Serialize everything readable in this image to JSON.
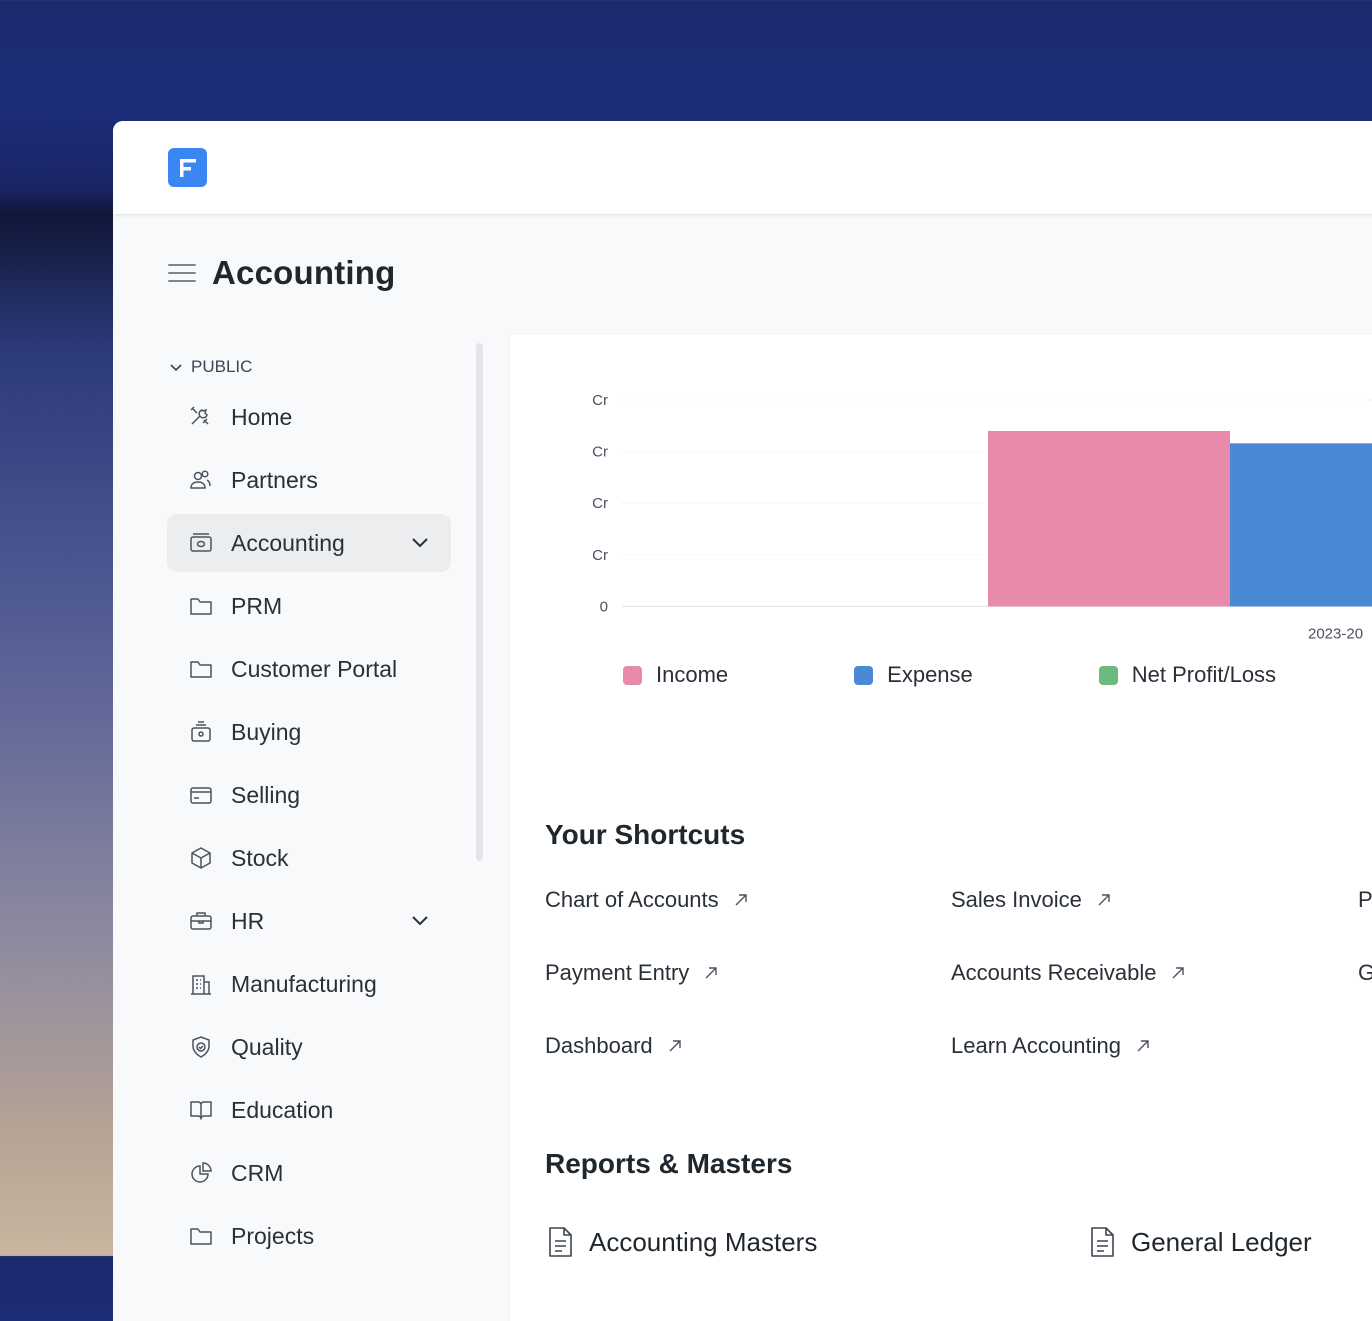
{
  "app": {
    "logo_letter": "F"
  },
  "page": {
    "title": "Accounting"
  },
  "sidebar": {
    "section": "PUBLIC",
    "items": [
      {
        "label": "Home",
        "icon": "tools-icon"
      },
      {
        "label": "Partners",
        "icon": "users-icon"
      },
      {
        "label": "Accounting",
        "icon": "money-icon",
        "active": true,
        "expandable": true
      },
      {
        "label": "PRM",
        "icon": "folder-icon"
      },
      {
        "label": "Customer Portal",
        "icon": "folder-icon"
      },
      {
        "label": "Buying",
        "icon": "shopping-icon"
      },
      {
        "label": "Selling",
        "icon": "card-icon"
      },
      {
        "label": "Stock",
        "icon": "box-icon"
      },
      {
        "label": "HR",
        "icon": "briefcase-icon",
        "expandable": true
      },
      {
        "label": "Manufacturing",
        "icon": "building-icon"
      },
      {
        "label": "Quality",
        "icon": "shield-icon"
      },
      {
        "label": "Education",
        "icon": "book-icon"
      },
      {
        "label": "CRM",
        "icon": "pie-icon"
      },
      {
        "label": "Projects",
        "icon": "folder-icon"
      }
    ]
  },
  "chart_data": {
    "type": "bar",
    "y_ticks": [
      "Cr",
      "Cr",
      "Cr",
      "Cr",
      "0"
    ],
    "x_label_visible": "2023-20",
    "series": [
      {
        "name": "Income",
        "color": "#e88aab",
        "value_fraction_of_top_tick": 0.85
      },
      {
        "name": "Expense",
        "color": "#4a89d4",
        "value_fraction_of_top_tick": 0.79
      },
      {
        "name": "Net Profit/Loss",
        "color": "#6cba7f"
      }
    ]
  },
  "shortcuts": {
    "title": "Your Shortcuts",
    "items": [
      "Chart of Accounts",
      "Sales Invoice",
      "P",
      "Payment Entry",
      "Accounts Receivable",
      "G",
      "Dashboard",
      "Learn Accounting"
    ]
  },
  "reports": {
    "title": "Reports & Masters",
    "items": [
      "Accounting Masters",
      "General Ledger"
    ]
  }
}
